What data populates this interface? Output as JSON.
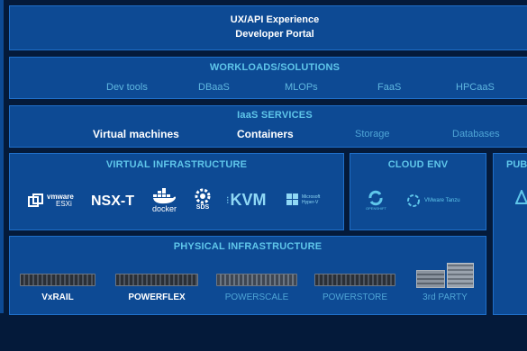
{
  "ux": {
    "line1": "UX/API Experience",
    "line2": "Developer Portal"
  },
  "workloads": {
    "title": "WORKLOADS/SOLUTIONS",
    "items": [
      "Dev tools",
      "DBaaS",
      "MLOPs",
      "FaaS",
      "HPCaaS"
    ]
  },
  "iaas": {
    "title": "IaaS SERVICES",
    "items": [
      "Virtual machines",
      "Containers",
      "Storage",
      "Databases"
    ]
  },
  "virtual": {
    "title": "VIRTUAL INFRASTRUCTURE",
    "logos": {
      "vmware_brand": "vmware",
      "vmware_product": "ESXi",
      "nsx": "NSX-T",
      "docker": "docker",
      "sds": "SDS",
      "kvm": "KVM",
      "hyperv_brand": "Microsoft",
      "hyperv_product": "Hyper-V"
    }
  },
  "cloud": {
    "title": "CLOUD ENV",
    "openshift": "OPENSHIFT",
    "tanzu": "VMware Tanzu"
  },
  "public": {
    "title": "PUB"
  },
  "physical": {
    "title": "PHYSICAL INFRASTRUCTURE",
    "items": [
      "VxRAIL",
      "POWERFLEX",
      "POWERSCALE",
      "POWERSTORE",
      "3rd PARTY"
    ]
  },
  "colors": {
    "panel": "#0d4a94",
    "border": "#1f6fc9",
    "header": "#5fc6ea",
    "background": "#041a3a",
    "dim_text": "#4fa5d6"
  }
}
